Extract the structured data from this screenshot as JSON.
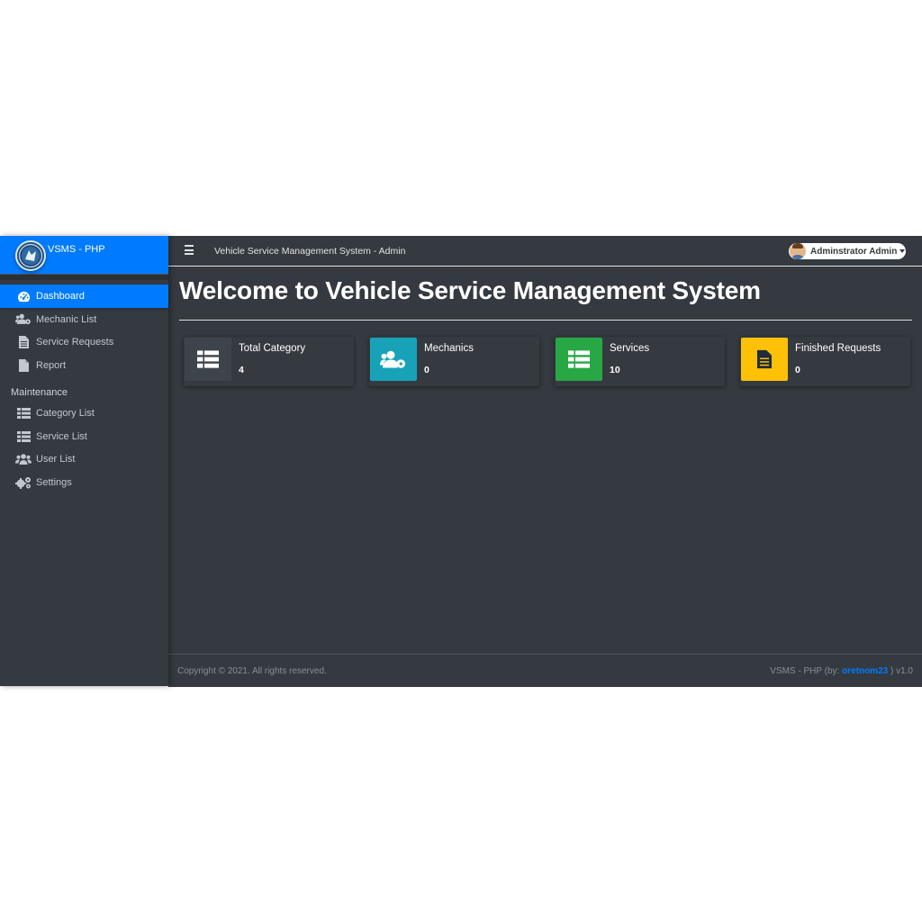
{
  "brand": {
    "name": "VSMS - PHP"
  },
  "sidebar": {
    "items": [
      {
        "label": "Dashboard",
        "icon": "tachometer-icon"
      },
      {
        "label": "Mechanic List",
        "icon": "users-cog-icon"
      },
      {
        "label": "Service Requests",
        "icon": "file-alt-icon"
      },
      {
        "label": "Report",
        "icon": "file-icon"
      }
    ],
    "section_header": "Maintenance",
    "maintenance_items": [
      {
        "label": "Category List",
        "icon": "th-list-icon"
      },
      {
        "label": "Service List",
        "icon": "th-list-icon"
      },
      {
        "label": "User List",
        "icon": "users-icon"
      },
      {
        "label": "Settings",
        "icon": "cogs-icon"
      }
    ]
  },
  "topbar": {
    "title": "Vehicle Service Management System - Admin",
    "user_name": "Adminstrator Admin"
  },
  "main": {
    "title": "Welcome to Vehicle Service Management System",
    "cards": [
      {
        "label": "Total Category",
        "value": "4",
        "color": "#3d444b",
        "icon": "th-list-icon"
      },
      {
        "label": "Mechanics",
        "value": "0",
        "color": "#17a2b8",
        "icon": "users-cog-icon"
      },
      {
        "label": "Services",
        "value": "10",
        "color": "#28a745",
        "icon": "th-list-icon"
      },
      {
        "label": "Finished Requests",
        "value": "0",
        "color": "#ffc107",
        "icon": "file-alt-icon"
      }
    ]
  },
  "footer": {
    "copyright": "Copyright © 2021. All rights reserved.",
    "credit_prefix": "VSMS - PHP (by: ",
    "credit_author": "oretnom23",
    "credit_suffix": " ) v1.0"
  },
  "colors": {
    "accent": "#007bff",
    "background": "#343a40",
    "info": "#17a2b8",
    "success": "#28a745",
    "warning": "#ffc107"
  }
}
